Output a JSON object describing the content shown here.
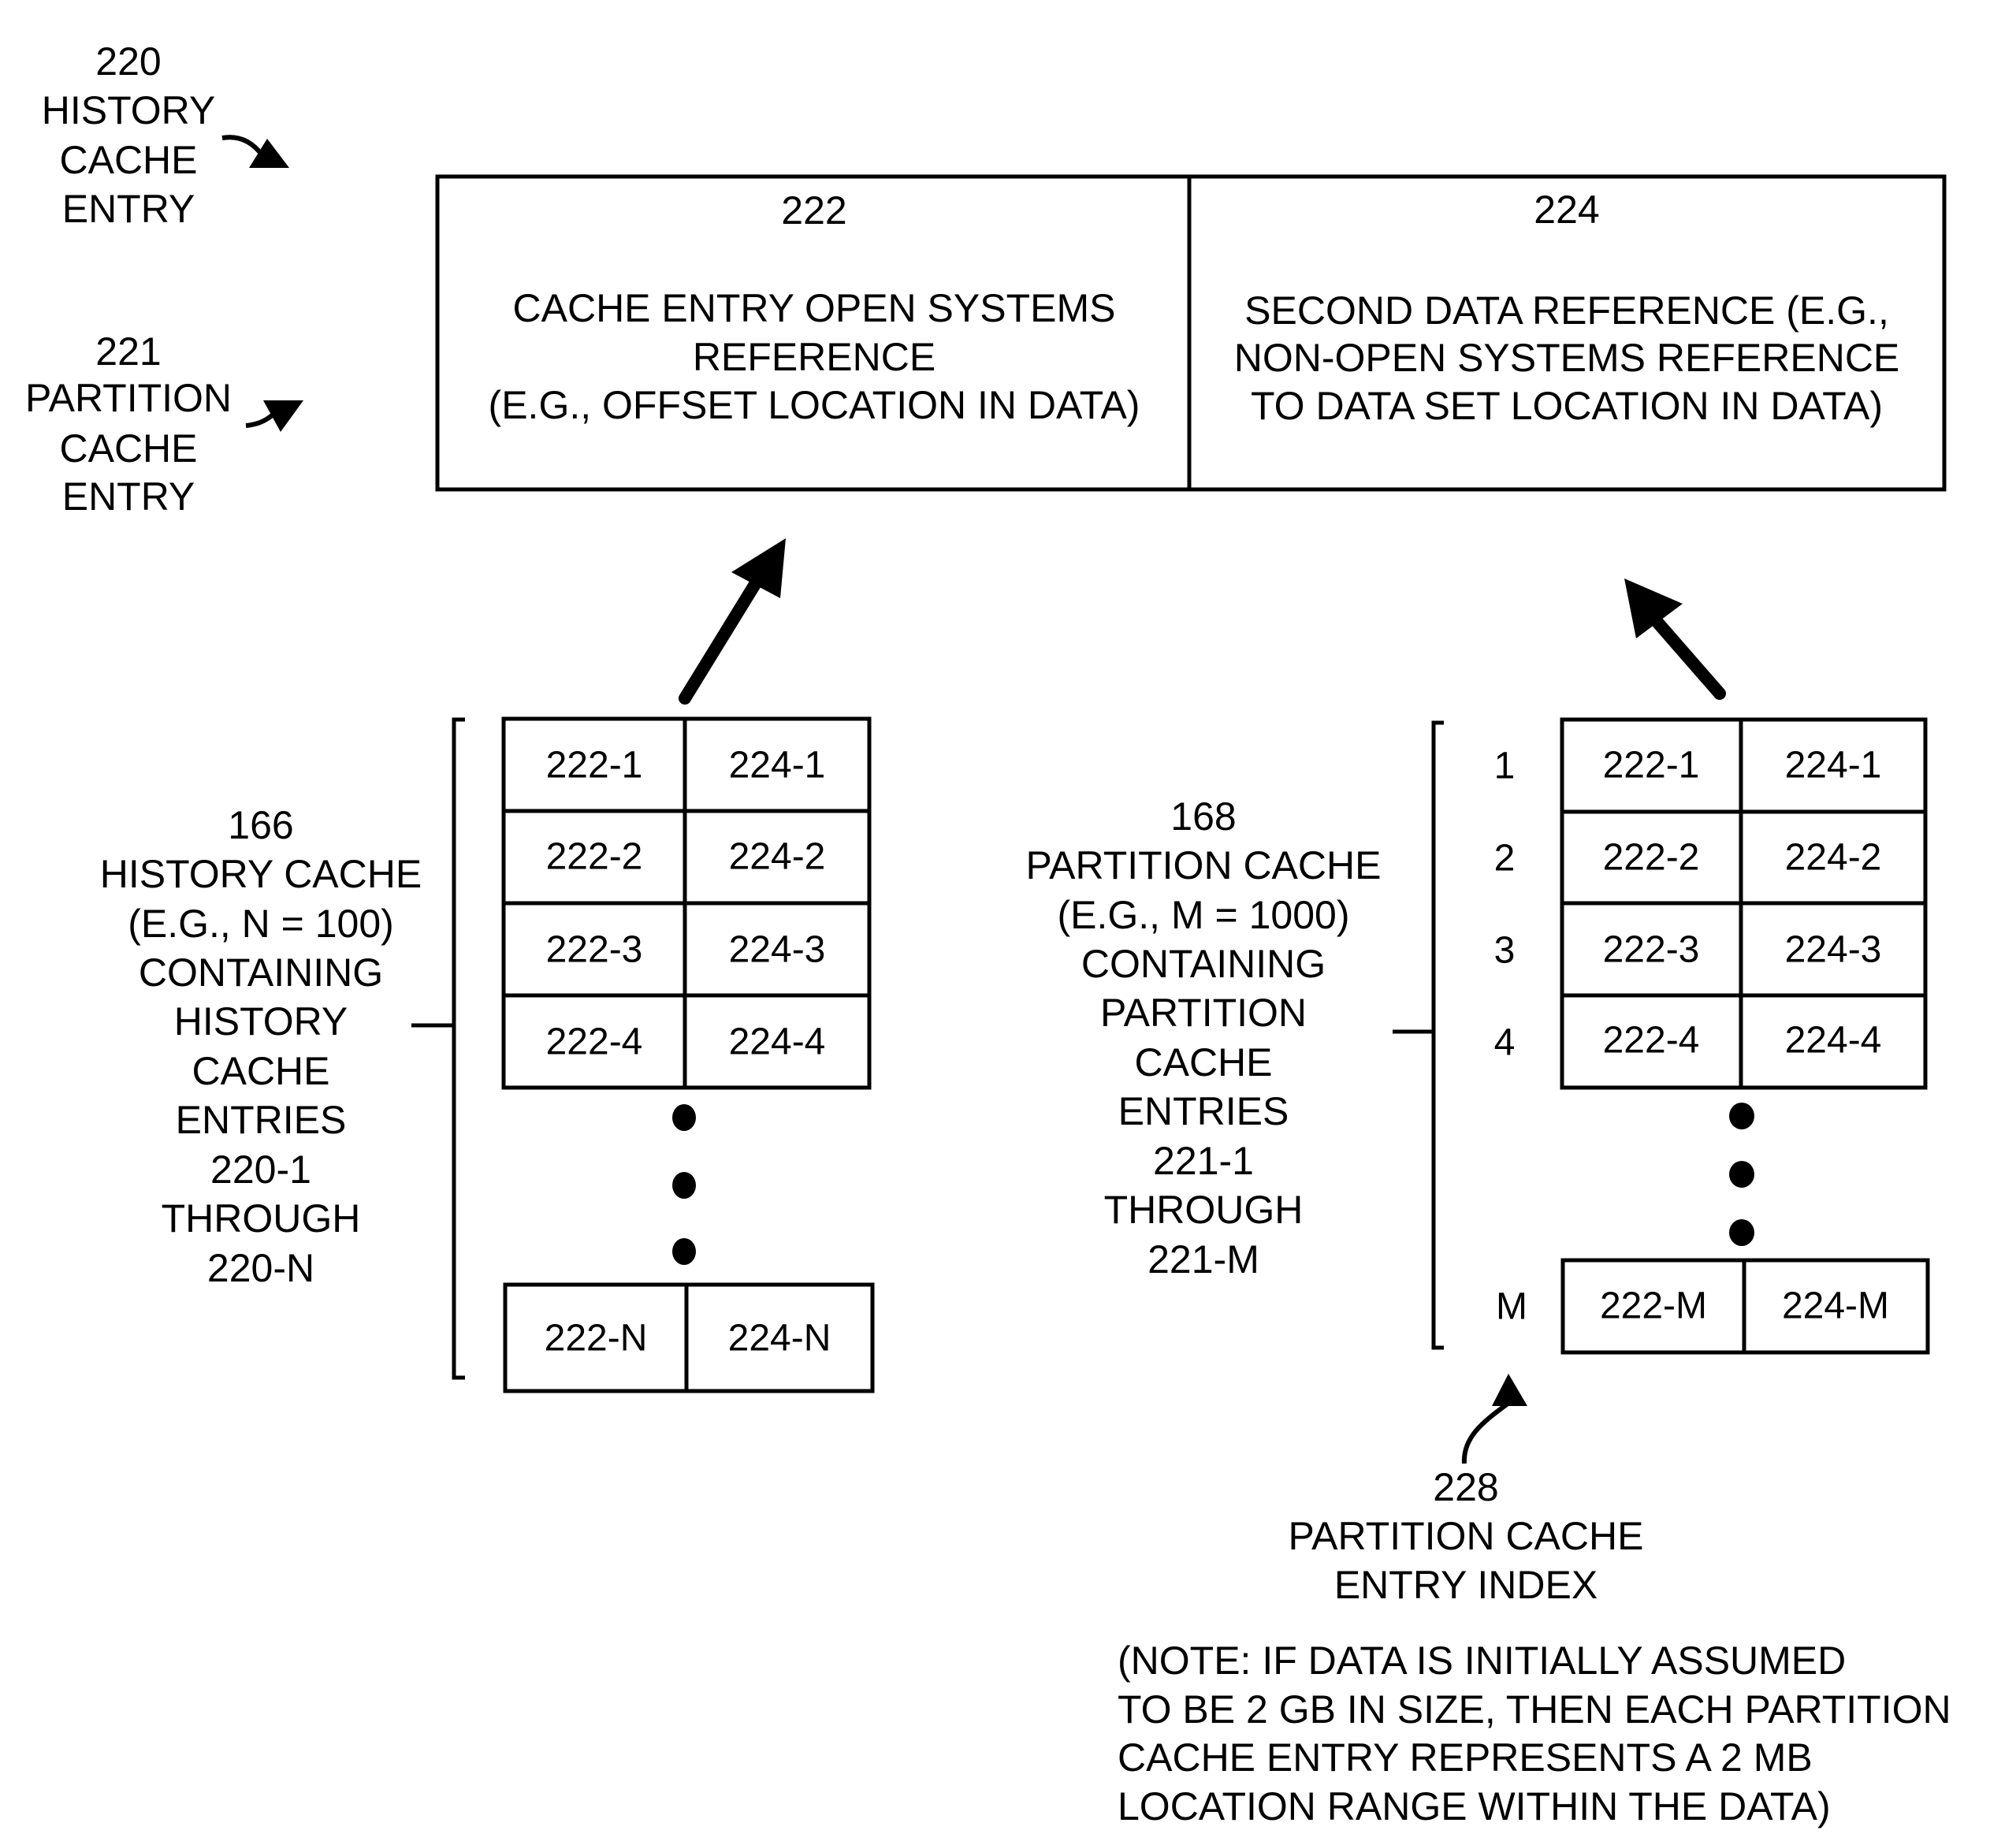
{
  "labels": {
    "history_entry": [
      "220",
      "HISTORY",
      "CACHE",
      "ENTRY"
    ],
    "partition_entry": [
      "221",
      "PARTITION",
      "CACHE",
      "ENTRY"
    ]
  },
  "entry_box": {
    "left": {
      "ref": "222",
      "lines": [
        "CACHE ENTRY OPEN SYSTEMS",
        "REFERENCE",
        "(E.G., OFFSET LOCATION IN DATA)"
      ]
    },
    "right": {
      "ref": "224",
      "lines": [
        "SECOND DATA REFERENCE (E.G.,",
        "NON-OPEN SYSTEMS REFERENCE",
        "TO DATA SET LOCATION IN DATA)"
      ]
    }
  },
  "history_cache": {
    "description": [
      "166",
      "HISTORY CACHE",
      "(E.G., N = 100)",
      "CONTAINING",
      "HISTORY",
      "CACHE",
      "ENTRIES",
      "220-1",
      "THROUGH",
      "220-N"
    ],
    "rows": [
      [
        "222-1",
        "224-1"
      ],
      [
        "222-2",
        "224-2"
      ],
      [
        "222-3",
        "224-3"
      ],
      [
        "222-4",
        "224-4"
      ]
    ],
    "last_row": [
      "222-N",
      "224-N"
    ]
  },
  "partition_cache": {
    "description": [
      "168",
      "PARTITION CACHE",
      "(E.G., M = 1000)",
      "CONTAINING",
      "PARTITION",
      "CACHE",
      "ENTRIES",
      "221-1",
      "THROUGH",
      "221-M"
    ],
    "indices": [
      "1",
      "2",
      "3",
      "4"
    ],
    "rows": [
      [
        "222-1",
        "224-1"
      ],
      [
        "222-2",
        "224-2"
      ],
      [
        "222-3",
        "224-3"
      ],
      [
        "222-4",
        "224-4"
      ]
    ],
    "last_index": "M",
    "last_row": [
      "222-M",
      "224-M"
    ]
  },
  "index_label": [
    "228",
    "PARTITION CACHE",
    "ENTRY INDEX"
  ],
  "note": [
    "(NOTE: IF DATA IS INITIALLY ASSUMED",
    "TO BE 2 GB IN SIZE, THEN EACH PARTITION",
    "CACHE ENTRY REPRESENTS A 2 MB",
    "LOCATION RANGE WITHIN THE DATA)"
  ]
}
